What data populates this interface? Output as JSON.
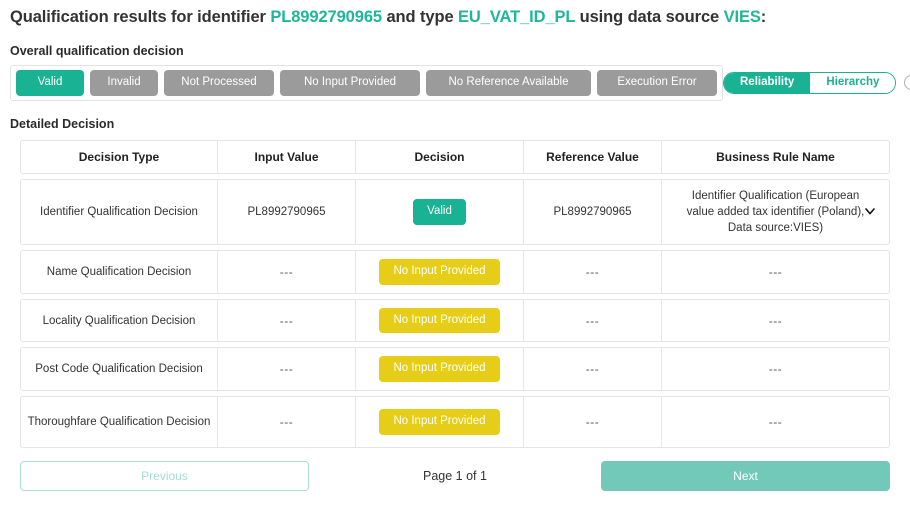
{
  "header": {
    "prefix": "Qualification results for identifier ",
    "identifier": "PL8992790965",
    "mid": " and type ",
    "type": "EU_VAT_ID_PL",
    "mid2": " using data source ",
    "source": "VIES",
    "suffix": ":"
  },
  "sections": {
    "overall_label": "Overall qualification decision",
    "detailed_label": "Detailed Decision"
  },
  "legend": {
    "chips": [
      {
        "label": "Valid",
        "state": "active"
      },
      {
        "label": "Invalid",
        "state": "inactive"
      },
      {
        "label": "Not Processed",
        "state": "inactive"
      },
      {
        "label": "No Input Provided",
        "state": "inactive"
      },
      {
        "label": "No Reference Available",
        "state": "inactive"
      },
      {
        "label": "Execution Error",
        "state": "inactive"
      }
    ]
  },
  "toggle": {
    "active_label": "Reliability",
    "inactive_label": "Hierarchy",
    "info_glyph": "i"
  },
  "table": {
    "columns": [
      "Decision Type",
      "Input Value",
      "Decision",
      "Reference Value",
      "Business Rule Name"
    ],
    "rows": [
      {
        "decision_type": "Identifier Qualification Decision",
        "input_value": "PL8992790965",
        "decision": "Valid",
        "decision_color": "teal",
        "reference_value": "PL8992790965",
        "business_rule": "Identifier Qualification (European value added tax identifier (Poland), Data source:VIES)",
        "has_chevron": true
      },
      {
        "decision_type": "Name Qualification Decision",
        "input_value": "---",
        "decision": "No Input Provided",
        "decision_color": "yellow",
        "reference_value": "---",
        "business_rule": "---",
        "has_chevron": false
      },
      {
        "decision_type": "Locality Qualification Decision",
        "input_value": "---",
        "decision": "No Input Provided",
        "decision_color": "yellow",
        "reference_value": "---",
        "business_rule": "---",
        "has_chevron": false
      },
      {
        "decision_type": "Post Code Qualification Decision",
        "input_value": "---",
        "decision": "No Input Provided",
        "decision_color": "yellow",
        "reference_value": "---",
        "business_rule": "---",
        "has_chevron": false
      },
      {
        "decision_type": "Thoroughfare Qualification Decision",
        "input_value": "---",
        "decision": "No Input Provided",
        "decision_color": "yellow",
        "reference_value": "---",
        "business_rule": "---",
        "has_chevron": false
      }
    ]
  },
  "pagination": {
    "previous_label": "Previous",
    "page_indicator": "Page 1 of 1",
    "next_label": "Next"
  },
  "colors": {
    "accent_teal": "#19b394",
    "warning_yellow": "#e6cd17",
    "neutral_grey": "#9b9b9b",
    "next_button_teal": "#72c9ba"
  }
}
